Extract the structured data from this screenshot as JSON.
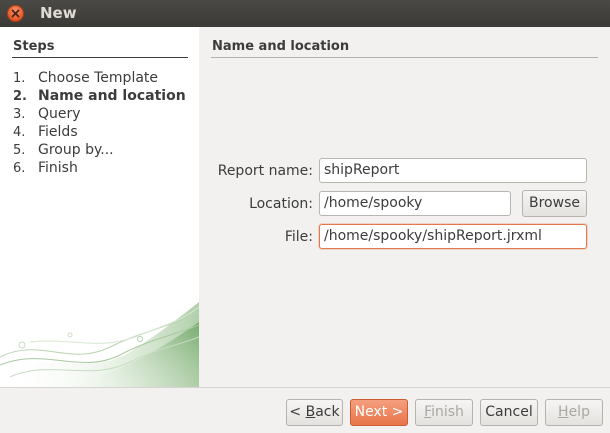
{
  "window": {
    "title": "New"
  },
  "steps": {
    "header": "Steps",
    "items": [
      {
        "num": "1.",
        "label": "Choose Template"
      },
      {
        "num": "2.",
        "label": "Name and location"
      },
      {
        "num": "3.",
        "label": "Query"
      },
      {
        "num": "4.",
        "label": "Fields"
      },
      {
        "num": "5.",
        "label": "Group by..."
      },
      {
        "num": "6.",
        "label": "Finish"
      }
    ],
    "current_index": 1
  },
  "main": {
    "title": "Name and location",
    "report_name": {
      "label": "Report name:",
      "value": "shipReport"
    },
    "location": {
      "label": "Location:",
      "value": "/home/spooky",
      "browse_label": "Browse"
    },
    "file": {
      "label": "File:",
      "value": "/home/spooky/shipReport.jrxml"
    }
  },
  "buttons": {
    "back": {
      "label_prefix": "< ",
      "label_mnemonic": "B",
      "label_rest": "ack"
    },
    "next": "Next >",
    "finish": {
      "mnemonic": "F",
      "rest": "inish"
    },
    "cancel": "Cancel",
    "help": {
      "mnemonic": "H",
      "rest": "elp"
    }
  },
  "colors": {
    "accent": "#e8744a",
    "titlebar": "#3b3a37",
    "window_bg": "#f2f1f0"
  },
  "icons": {
    "close": "close-icon"
  }
}
